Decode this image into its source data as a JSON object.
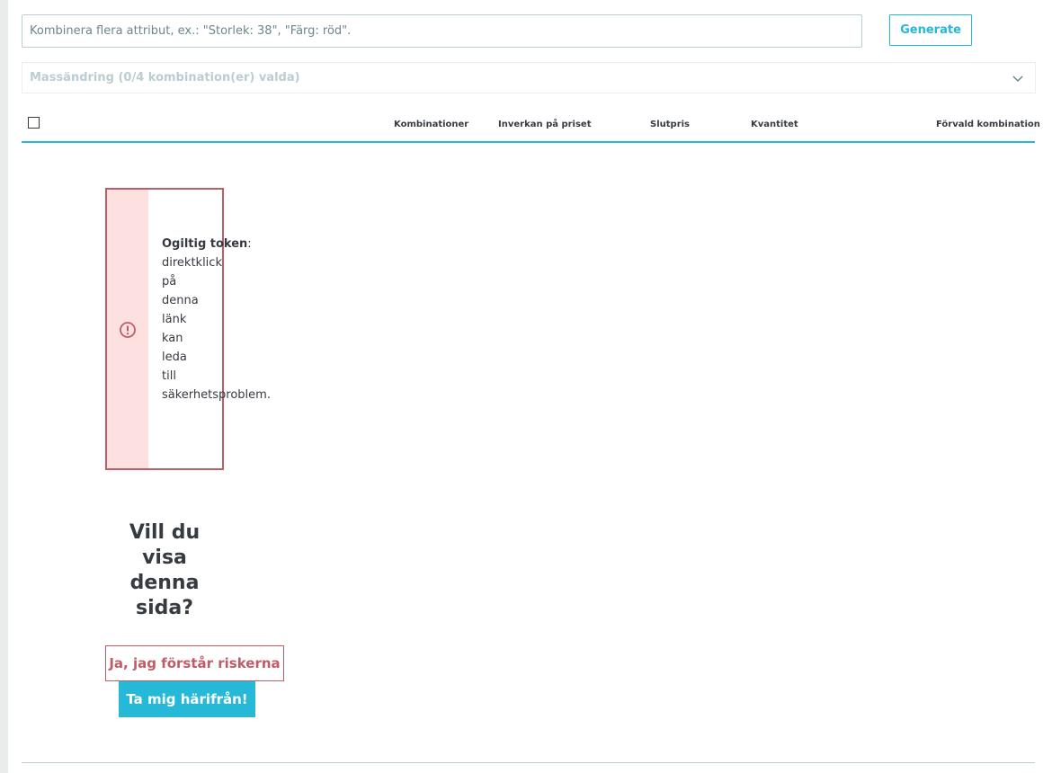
{
  "generator": {
    "placeholder": "Kombinera flera attribut, ex.: \"Storlek: 38\", \"Färg: röd\".",
    "button_label": "Generate"
  },
  "bulk_edit": {
    "label": "Massändring (0/4 kombination(er) valda)",
    "icon": "chevron-down-icon"
  },
  "table": {
    "columns": [
      "Kombinationer",
      "Inverkan på priset",
      "Slutpris",
      "Kvantitet",
      "Förvald kombination"
    ]
  },
  "alert": {
    "icon": "exclamation-circle-icon",
    "title": "Ogiltig token",
    "separator": ":",
    "message_words": [
      "direktklick",
      "på",
      "denna",
      "länk",
      "kan",
      "leda",
      "till",
      "säkerhetsproblem."
    ]
  },
  "question": {
    "title": "Vill du visa denna sida?"
  },
  "actions": {
    "accept_label": "Ja, jag förstår riskerna",
    "leave_label": "Ta mig härifrån!"
  },
  "colors": {
    "accent": "#25b9d7",
    "danger": "#c05c67",
    "danger_bg": "#fde1e1",
    "text": "#363a41",
    "muted": "#bbcdd2"
  }
}
